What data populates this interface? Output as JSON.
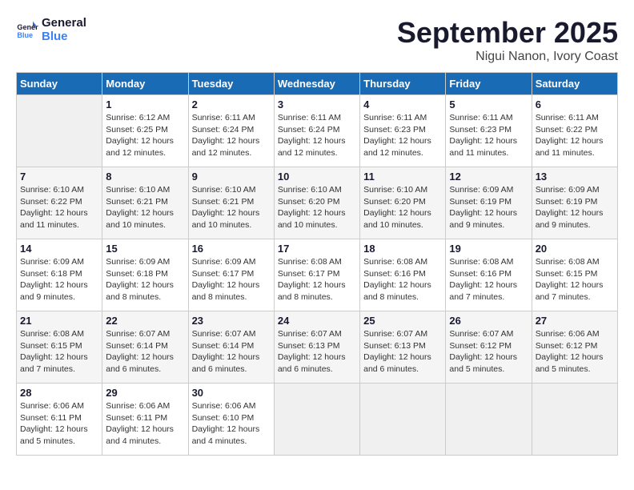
{
  "logo": {
    "line1": "General",
    "line2": "Blue"
  },
  "title": "September 2025",
  "location": "Nigui Nanon, Ivory Coast",
  "days_of_week": [
    "Sunday",
    "Monday",
    "Tuesday",
    "Wednesday",
    "Thursday",
    "Friday",
    "Saturday"
  ],
  "weeks": [
    [
      {
        "num": "",
        "info": ""
      },
      {
        "num": "1",
        "info": "Sunrise: 6:12 AM\nSunset: 6:25 PM\nDaylight: 12 hours\nand 12 minutes."
      },
      {
        "num": "2",
        "info": "Sunrise: 6:11 AM\nSunset: 6:24 PM\nDaylight: 12 hours\nand 12 minutes."
      },
      {
        "num": "3",
        "info": "Sunrise: 6:11 AM\nSunset: 6:24 PM\nDaylight: 12 hours\nand 12 minutes."
      },
      {
        "num": "4",
        "info": "Sunrise: 6:11 AM\nSunset: 6:23 PM\nDaylight: 12 hours\nand 12 minutes."
      },
      {
        "num": "5",
        "info": "Sunrise: 6:11 AM\nSunset: 6:23 PM\nDaylight: 12 hours\nand 11 minutes."
      },
      {
        "num": "6",
        "info": "Sunrise: 6:11 AM\nSunset: 6:22 PM\nDaylight: 12 hours\nand 11 minutes."
      }
    ],
    [
      {
        "num": "7",
        "info": "Sunrise: 6:10 AM\nSunset: 6:22 PM\nDaylight: 12 hours\nand 11 minutes."
      },
      {
        "num": "8",
        "info": "Sunrise: 6:10 AM\nSunset: 6:21 PM\nDaylight: 12 hours\nand 10 minutes."
      },
      {
        "num": "9",
        "info": "Sunrise: 6:10 AM\nSunset: 6:21 PM\nDaylight: 12 hours\nand 10 minutes."
      },
      {
        "num": "10",
        "info": "Sunrise: 6:10 AM\nSunset: 6:20 PM\nDaylight: 12 hours\nand 10 minutes."
      },
      {
        "num": "11",
        "info": "Sunrise: 6:10 AM\nSunset: 6:20 PM\nDaylight: 12 hours\nand 10 minutes."
      },
      {
        "num": "12",
        "info": "Sunrise: 6:09 AM\nSunset: 6:19 PM\nDaylight: 12 hours\nand 9 minutes."
      },
      {
        "num": "13",
        "info": "Sunrise: 6:09 AM\nSunset: 6:19 PM\nDaylight: 12 hours\nand 9 minutes."
      }
    ],
    [
      {
        "num": "14",
        "info": "Sunrise: 6:09 AM\nSunset: 6:18 PM\nDaylight: 12 hours\nand 9 minutes."
      },
      {
        "num": "15",
        "info": "Sunrise: 6:09 AM\nSunset: 6:18 PM\nDaylight: 12 hours\nand 8 minutes."
      },
      {
        "num": "16",
        "info": "Sunrise: 6:09 AM\nSunset: 6:17 PM\nDaylight: 12 hours\nand 8 minutes."
      },
      {
        "num": "17",
        "info": "Sunrise: 6:08 AM\nSunset: 6:17 PM\nDaylight: 12 hours\nand 8 minutes."
      },
      {
        "num": "18",
        "info": "Sunrise: 6:08 AM\nSunset: 6:16 PM\nDaylight: 12 hours\nand 8 minutes."
      },
      {
        "num": "19",
        "info": "Sunrise: 6:08 AM\nSunset: 6:16 PM\nDaylight: 12 hours\nand 7 minutes."
      },
      {
        "num": "20",
        "info": "Sunrise: 6:08 AM\nSunset: 6:15 PM\nDaylight: 12 hours\nand 7 minutes."
      }
    ],
    [
      {
        "num": "21",
        "info": "Sunrise: 6:08 AM\nSunset: 6:15 PM\nDaylight: 12 hours\nand 7 minutes."
      },
      {
        "num": "22",
        "info": "Sunrise: 6:07 AM\nSunset: 6:14 PM\nDaylight: 12 hours\nand 6 minutes."
      },
      {
        "num": "23",
        "info": "Sunrise: 6:07 AM\nSunset: 6:14 PM\nDaylight: 12 hours\nand 6 minutes."
      },
      {
        "num": "24",
        "info": "Sunrise: 6:07 AM\nSunset: 6:13 PM\nDaylight: 12 hours\nand 6 minutes."
      },
      {
        "num": "25",
        "info": "Sunrise: 6:07 AM\nSunset: 6:13 PM\nDaylight: 12 hours\nand 6 minutes."
      },
      {
        "num": "26",
        "info": "Sunrise: 6:07 AM\nSunset: 6:12 PM\nDaylight: 12 hours\nand 5 minutes."
      },
      {
        "num": "27",
        "info": "Sunrise: 6:06 AM\nSunset: 6:12 PM\nDaylight: 12 hours\nand 5 minutes."
      }
    ],
    [
      {
        "num": "28",
        "info": "Sunrise: 6:06 AM\nSunset: 6:11 PM\nDaylight: 12 hours\nand 5 minutes."
      },
      {
        "num": "29",
        "info": "Sunrise: 6:06 AM\nSunset: 6:11 PM\nDaylight: 12 hours\nand 4 minutes."
      },
      {
        "num": "30",
        "info": "Sunrise: 6:06 AM\nSunset: 6:10 PM\nDaylight: 12 hours\nand 4 minutes."
      },
      {
        "num": "",
        "info": ""
      },
      {
        "num": "",
        "info": ""
      },
      {
        "num": "",
        "info": ""
      },
      {
        "num": "",
        "info": ""
      }
    ]
  ]
}
